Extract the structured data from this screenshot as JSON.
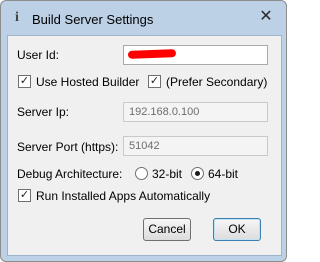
{
  "window": {
    "title": "Build Server Settings",
    "icon": "info-icon",
    "close": "✕"
  },
  "form": {
    "user_id_label": "User Id:",
    "user_id_value": "",
    "use_hosted_builder_label": "Use Hosted Builder",
    "use_hosted_builder_checked": true,
    "prefer_secondary_label": "(Prefer Secondary)",
    "prefer_secondary_checked": true,
    "server_ip_label": "Server Ip:",
    "server_ip_value": "192.168.0.100",
    "server_port_label": "Server Port (https):",
    "server_port_value": "51042",
    "debug_arch_label": "Debug Architecture:",
    "arch_options": [
      "32-bit",
      "64-bit"
    ],
    "arch_selected": "64-bit",
    "run_installed_label": "Run Installed Apps Automatically",
    "run_installed_checked": true
  },
  "buttons": {
    "cancel": "Cancel",
    "ok": "OK"
  },
  "colors": {
    "redaction": "#ff0000",
    "title_bar": "#bcd0e6",
    "client_bg": "#f0f0f0"
  }
}
